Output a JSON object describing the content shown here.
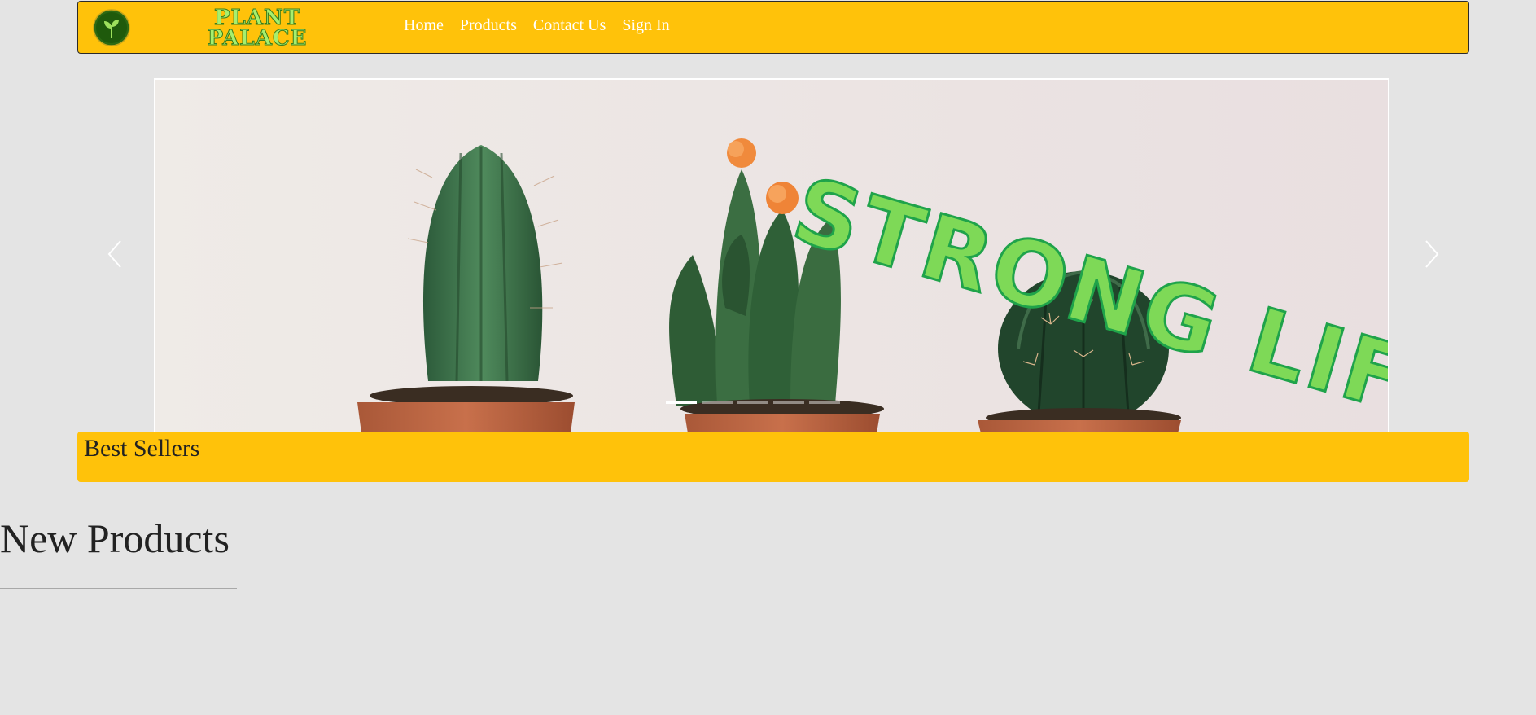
{
  "brand": {
    "line1": "PLANT",
    "line2": "PALACE",
    "logo_icon": "sprout-icon"
  },
  "nav": {
    "items": [
      {
        "label": "Home"
      },
      {
        "label": "Products"
      },
      {
        "label": "Contact Us"
      },
      {
        "label": "Sign In"
      }
    ]
  },
  "carousel": {
    "slide_text": "STRONG LIFE!",
    "slide_image": "three potted cacti",
    "prev_icon": "chevron-left-icon",
    "next_icon": "chevron-right-icon",
    "active_index": 0,
    "slide_count": 5
  },
  "sections": {
    "best_sellers": "Best Sellers",
    "new_products": "New Products"
  },
  "colors": {
    "accent": "#ffc20a",
    "background": "#e4e4e4",
    "slogan_fill": "#7ed957",
    "slogan_stroke": "#1fa34a",
    "brand_text": "#a6ef6e"
  }
}
